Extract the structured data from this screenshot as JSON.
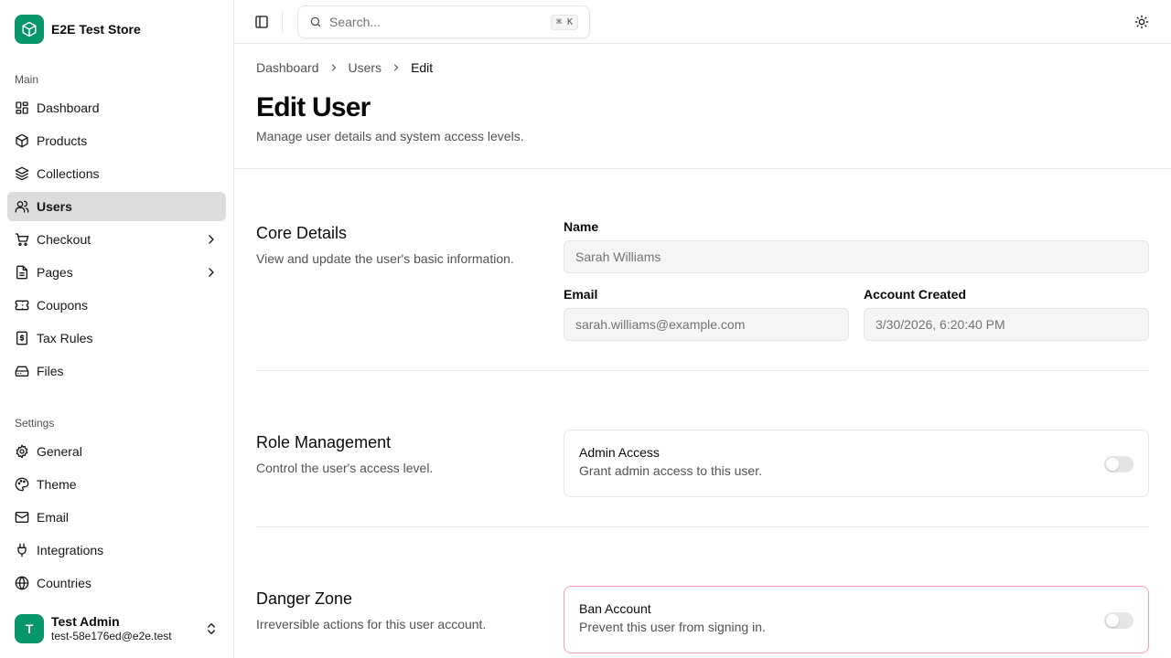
{
  "store": {
    "name": "E2E Test Store",
    "logo_icon": "box-icon",
    "brand_color": "#059669"
  },
  "sidebar": {
    "main_label": "Main",
    "main_items": [
      {
        "label": "Dashboard",
        "icon": "dashboard-icon"
      },
      {
        "label": "Products",
        "icon": "package-icon"
      },
      {
        "label": "Collections",
        "icon": "layers-icon"
      },
      {
        "label": "Users",
        "icon": "users-icon",
        "active": true
      },
      {
        "label": "Checkout",
        "icon": "cart-icon",
        "expandable": true
      },
      {
        "label": "Pages",
        "icon": "file-icon",
        "expandable": true
      },
      {
        "label": "Coupons",
        "icon": "ticket-icon"
      },
      {
        "label": "Tax Rules",
        "icon": "receipt-icon"
      },
      {
        "label": "Files",
        "icon": "hard-drive-icon"
      }
    ],
    "settings_label": "Settings",
    "settings_items": [
      {
        "label": "General",
        "icon": "gear-icon"
      },
      {
        "label": "Theme",
        "icon": "palette-icon"
      },
      {
        "label": "Email",
        "icon": "mail-icon"
      },
      {
        "label": "Integrations",
        "icon": "plug-icon"
      },
      {
        "label": "Countries",
        "icon": "globe-icon"
      }
    ],
    "user": {
      "initial": "T",
      "name": "Test Admin",
      "email": "test-58e176ed@e2e.test"
    }
  },
  "topbar": {
    "search_placeholder": "Search...",
    "search_shortcut": "⌘ K"
  },
  "breadcrumb": {
    "items": [
      "Dashboard",
      "Users"
    ],
    "current": "Edit"
  },
  "page": {
    "title": "Edit User",
    "subtitle": "Manage user details and system access levels."
  },
  "core": {
    "title": "Core Details",
    "desc": "View and update the user's basic information.",
    "name_label": "Name",
    "name_value": "Sarah Williams",
    "email_label": "Email",
    "email_value": "sarah.williams@example.com",
    "created_label": "Account Created",
    "created_value": "3/30/2026, 6:20:40 PM"
  },
  "role": {
    "title": "Role Management",
    "desc": "Control the user's access level.",
    "toggle_title": "Admin Access",
    "toggle_desc": "Grant admin access to this user.",
    "enabled": false
  },
  "danger": {
    "title": "Danger Zone",
    "desc": "Irreversible actions for this user account.",
    "toggle_title": "Ban Account",
    "toggle_desc": "Prevent this user from signing in.",
    "enabled": false,
    "border_color": "#f1a5ae"
  }
}
